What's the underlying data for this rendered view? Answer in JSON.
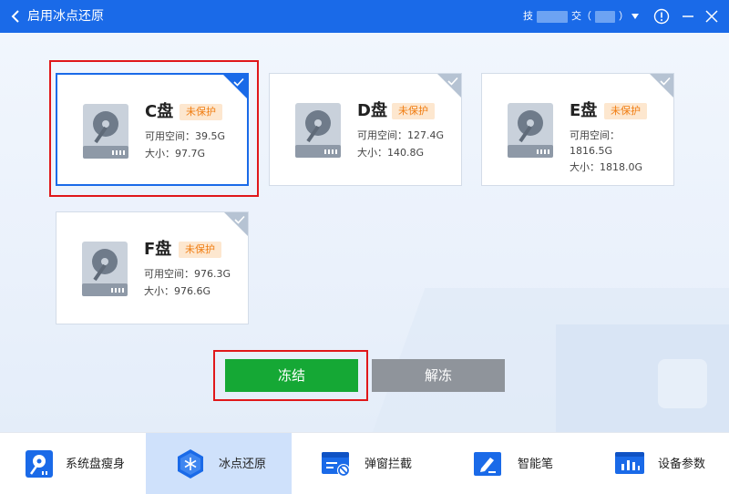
{
  "window": {
    "title": "启用冰点还原",
    "account_prefix": "技",
    "account_middle": "交（",
    "account_suffix": "）"
  },
  "icons": {
    "back": "chevron-left-icon",
    "dropdown": "caret-down-icon",
    "info": "info-circle-icon",
    "minimize": "minimize-icon",
    "close": "close-icon",
    "disk": "hard-disk-icon",
    "check": "check-icon"
  },
  "colors": {
    "titlebar": "#1a6ae8",
    "accent": "#1a6ae8",
    "freeze_button": "#15a835",
    "unfreeze_button": "#8f949b",
    "badge_text": "#f07d12",
    "badge_bg": "#fde7cf",
    "annotation_frame": "#e0171a",
    "nav_active": "#cfe1fb"
  },
  "disks": [
    {
      "name": "C盘",
      "status": "未保护",
      "free_line1": "可用空间：39.5G",
      "free_line2": "",
      "total": "大小：97.7G",
      "selected": true
    },
    {
      "name": "D盘",
      "status": "未保护",
      "free_line1": "可用空间：127.4G",
      "free_line2": "",
      "total": "大小：140.8G",
      "selected": false
    },
    {
      "name": "E盘",
      "status": "未保护",
      "free_line1": "可用空间：",
      "free_line2": "1816.5G",
      "total": "大小：1818.0G",
      "selected": false
    },
    {
      "name": "F盘",
      "status": "未保护",
      "free_line1": "可用空间：976.3G",
      "free_line2": "",
      "total": "大小：976.6G",
      "selected": false
    }
  ],
  "actions": {
    "freeze": "冻结",
    "unfreeze": "解冻"
  },
  "nav": [
    {
      "label": "系统盘瘦身",
      "icon": "disk-slim-icon",
      "active": false
    },
    {
      "label": "冰点还原",
      "icon": "snowflake-icon",
      "active": true
    },
    {
      "label": "弹窗拦截",
      "icon": "popup-block-icon",
      "active": false
    },
    {
      "label": "智能笔",
      "icon": "smart-pen-icon",
      "active": false
    },
    {
      "label": "设备参数",
      "icon": "device-params-icon",
      "active": false
    }
  ]
}
